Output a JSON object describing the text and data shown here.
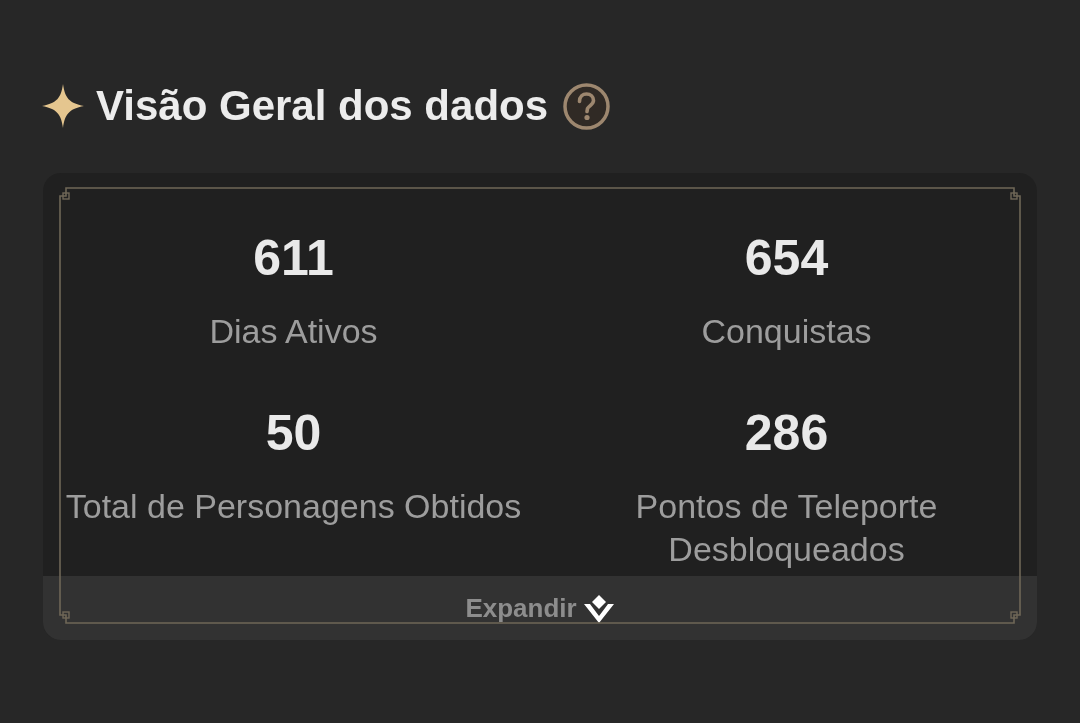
{
  "section": {
    "title": "Visão Geral dos dados"
  },
  "stats": [
    {
      "value": "611",
      "label": "Dias Ativos"
    },
    {
      "value": "654",
      "label": "Conquistas"
    },
    {
      "value": "50",
      "label": "Total de Personagens Obtidos"
    },
    {
      "value": "286",
      "label": "Pontos de Teleporte Desbloqueados"
    }
  ],
  "expand_button": {
    "label": "Expandir"
  }
}
